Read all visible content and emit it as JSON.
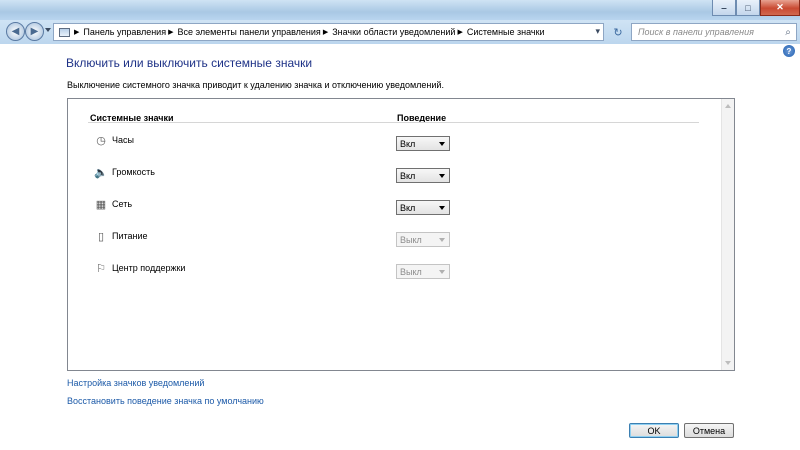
{
  "window": {
    "controls": {
      "minimize": "‒",
      "maximize": "□",
      "close": "✕"
    }
  },
  "nav": {
    "back_icon": "back-arrow-icon",
    "forward_icon": "forward-arrow-icon",
    "breadcrumbs": [
      "Панель управления",
      "Все элементы панели управления",
      "Значки области уведомлений",
      "Системные значки"
    ],
    "search_placeholder": "Поиск в панели управления"
  },
  "main": {
    "heading": "Включить или выключить системные значки",
    "description": "Выключение системного значка приводит к удалению значка и отключению уведомлений.",
    "columns": {
      "icons": "Системные значки",
      "behavior": "Поведение"
    },
    "rows": [
      {
        "name": "Часы",
        "icon": "clock-icon",
        "value": "Вкл",
        "enabled": true
      },
      {
        "name": "Громкость",
        "icon": "volume-icon",
        "value": "Вкл",
        "enabled": true
      },
      {
        "name": "Сеть",
        "icon": "network-icon",
        "value": "Вкл",
        "enabled": true
      },
      {
        "name": "Питание",
        "icon": "power-icon",
        "value": "Выкл",
        "enabled": false
      },
      {
        "name": "Центр поддержки",
        "icon": "action-center-flag-icon",
        "value": "Выкл",
        "enabled": false
      }
    ],
    "links": {
      "customize": "Настройка значков уведомлений",
      "restore": "Восстановить поведение значка по умолчанию"
    }
  },
  "buttons": {
    "ok": "OK",
    "cancel": "Отмена"
  }
}
